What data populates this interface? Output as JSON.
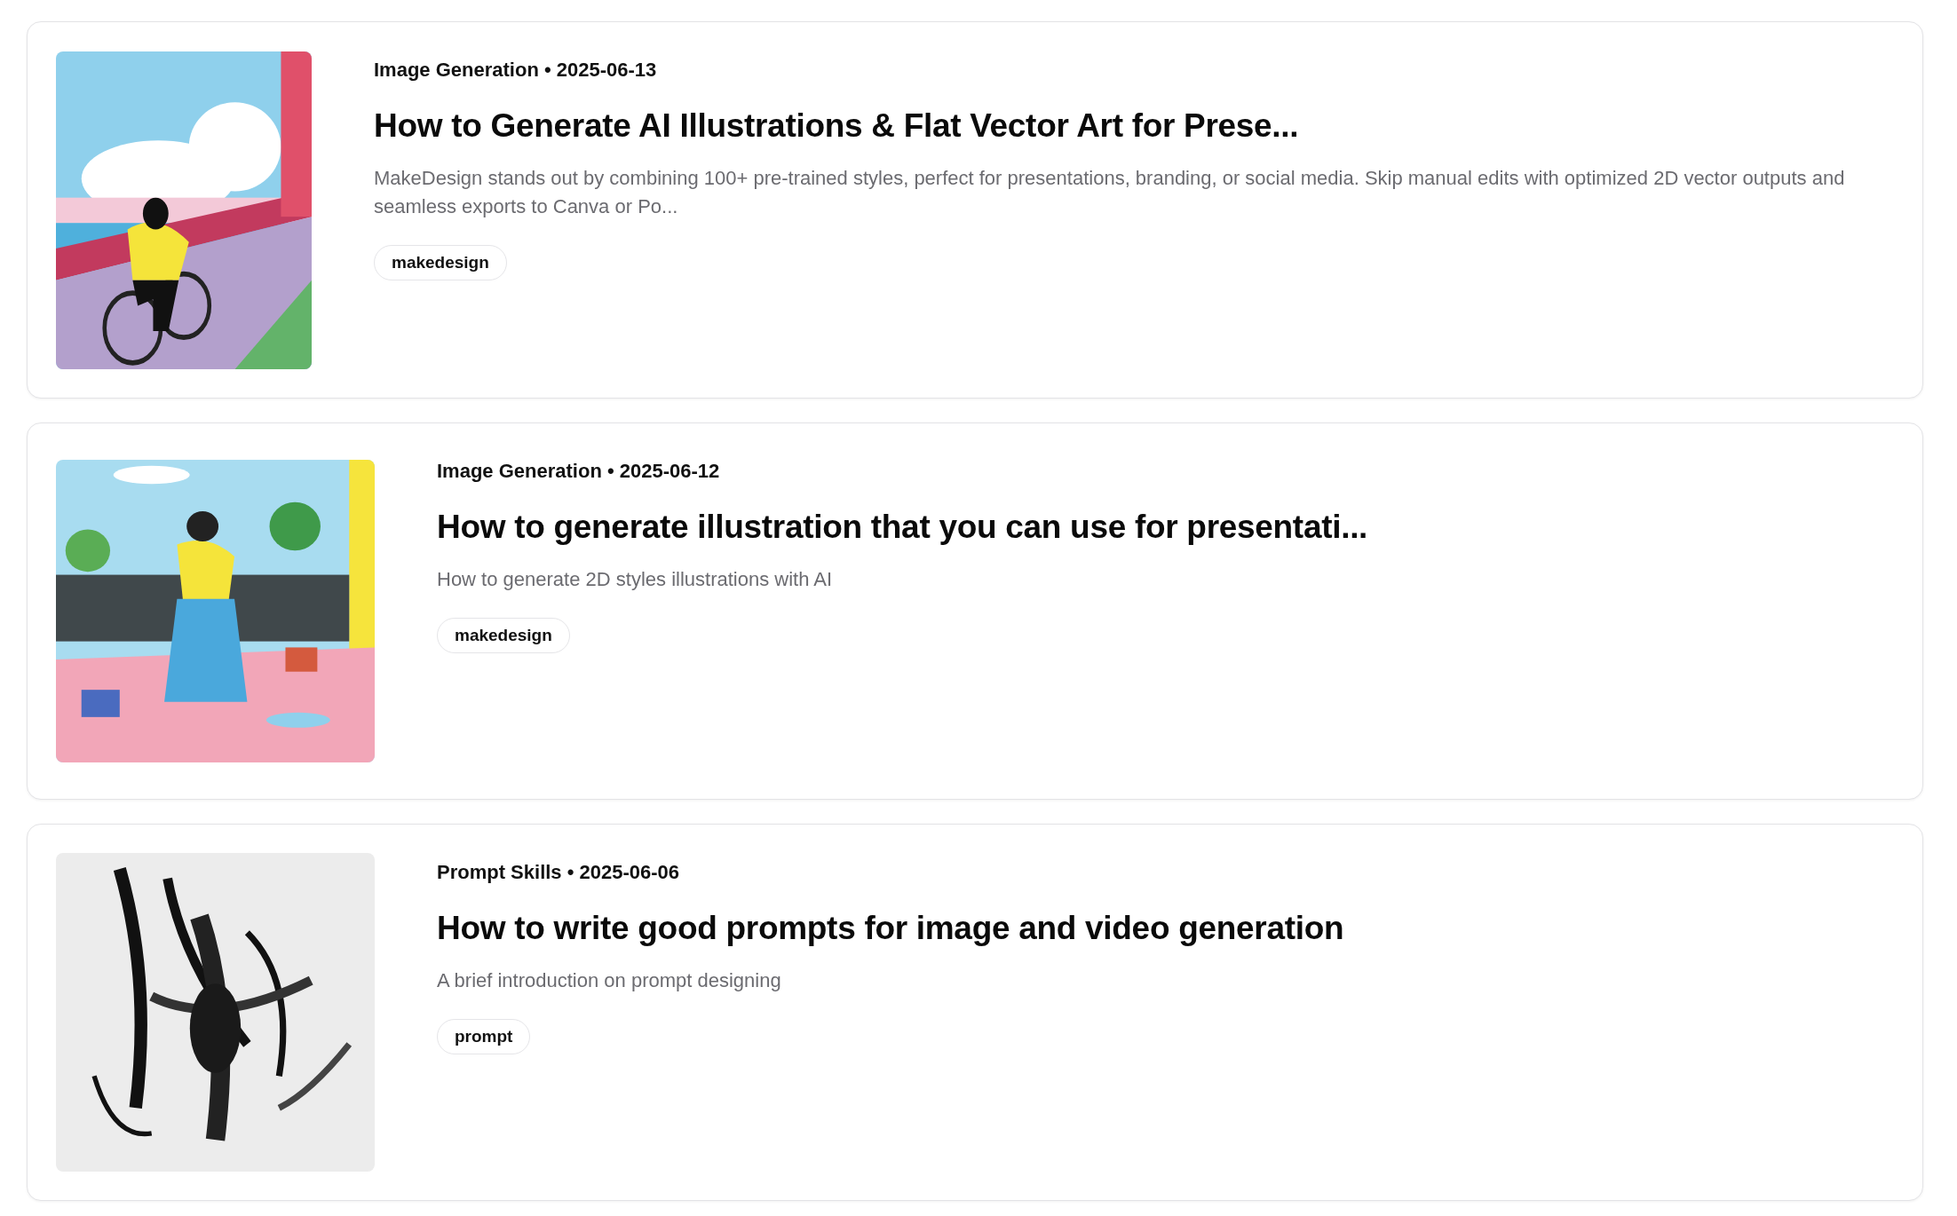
{
  "posts": [
    {
      "meta": "Image Generation • 2025-06-13",
      "title": "How to Generate AI Illustrations & Flat Vector Art for Prese...",
      "description": "MakeDesign stands out by combining 100+ pre-trained styles, perfect for presentations, branding, or social media. Skip manual edits with optimized 2D vector outputs and seamless exports to Canva or Po...",
      "tags": [
        "makedesign"
      ]
    },
    {
      "meta": "Image Generation • 2025-06-12",
      "title": "How to generate illustration that you can use for presentati...",
      "description": "How to generate 2D styles illustrations with AI",
      "tags": [
        "makedesign"
      ]
    },
    {
      "meta": "Prompt Skills • 2025-06-06",
      "title": "How to write good prompts for image and video generation",
      "description": "A brief introduction on prompt designing",
      "tags": [
        "prompt"
      ]
    }
  ]
}
